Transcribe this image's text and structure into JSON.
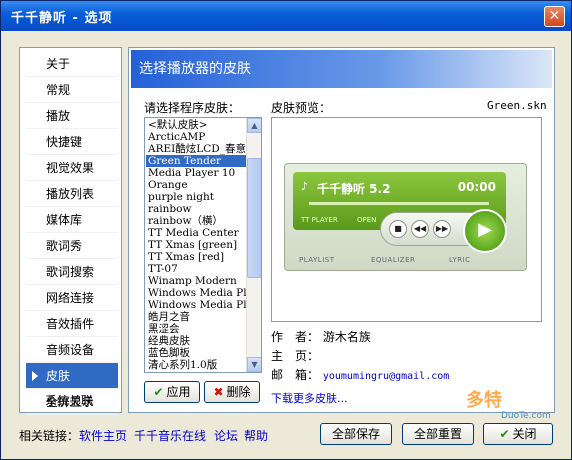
{
  "window": {
    "title": "千千静听 - 选项",
    "close_glyph": "✕"
  },
  "sidebar": {
    "items": [
      {
        "label": "关于"
      },
      {
        "label": "常规"
      },
      {
        "label": "播放"
      },
      {
        "label": "快捷键"
      },
      {
        "label": "视觉效果"
      },
      {
        "label": "播放列表"
      },
      {
        "label": "媒体库"
      },
      {
        "label": "歌词秀"
      },
      {
        "label": "歌词搜索"
      },
      {
        "label": "网络连接"
      },
      {
        "label": "音效插件"
      },
      {
        "label": "音频设备"
      },
      {
        "label": "皮肤",
        "active": true
      },
      {
        "label": "全屏显示"
      },
      {
        "label": "系统关联"
      }
    ]
  },
  "panel": {
    "header": "选择播放器的皮肤",
    "skins_label": "请选择程序皮肤：",
    "preview_label": "皮肤预览：",
    "preview_file": "Green.skn",
    "skins": [
      "<默认皮肤>",
      "ArcticAMP",
      "AREI酷炫LCD_春意",
      "Green Tender",
      "Media Player 10",
      "Orange",
      "purple night",
      "rainbow",
      "rainbow（横）",
      "TT Media Center",
      "TT Xmas [green]",
      "TT Xmas [red]",
      "TT-07",
      "Winamp Modern",
      "Windows Media Pl",
      "Windows Media Pl",
      "皓月之音",
      "黑涩会",
      "经典皮肤",
      "蓝色脚板",
      "清心系列1.0版"
    ],
    "selected_skin_index": 3,
    "preview_player": {
      "title": "千千静听 5.2",
      "time": "00:00",
      "tt_player": "TT PLAYER",
      "open": "OPEN",
      "tabs": [
        "PLAYLIST",
        "EQUALIZER",
        "LYRIC"
      ]
    },
    "author_label": "作　者：",
    "author_value": "游木名族",
    "homepage_label": "主　页：",
    "email_label": "邮　箱：",
    "email_value": "youmumingru@gmail.com",
    "more_skins_link": "下载更多皮肤..."
  },
  "buttons": {
    "apply": "应用",
    "delete": "删除",
    "save_all": "全部保存",
    "reset_all": "全部重置",
    "close": "关闭"
  },
  "footer": {
    "label": "相关链接：",
    "links": [
      "软件主页",
      "千千音乐在线",
      "论坛",
      "帮助"
    ]
  },
  "watermark": {
    "text": "多特",
    "sub": "DuoTe.com"
  },
  "colors": {
    "selection": "#316ac5",
    "title_bar": "#0a5fd8",
    "link": "#0000cc",
    "player_green": "#5a9a1a"
  }
}
